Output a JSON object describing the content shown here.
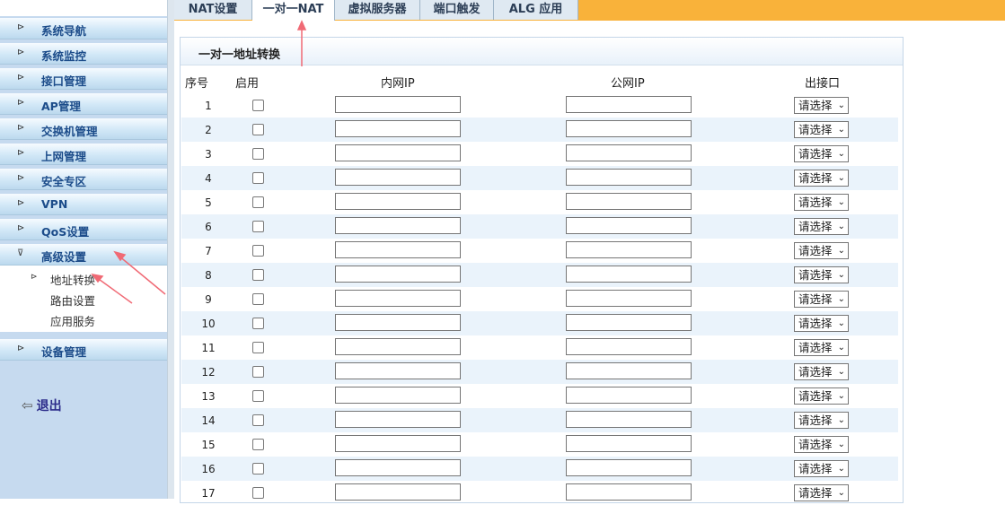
{
  "sidebar": {
    "items": [
      {
        "label": "系统导航"
      },
      {
        "label": "系统监控"
      },
      {
        "label": "接口管理"
      },
      {
        "label": "AP管理"
      },
      {
        "label": "交换机管理"
      },
      {
        "label": "上网管理"
      },
      {
        "label": "安全专区"
      },
      {
        "label": "VPN"
      },
      {
        "label": "QoS设置"
      },
      {
        "label": "高级设置"
      },
      {
        "label": "设备管理"
      }
    ],
    "submenu": [
      {
        "label": "地址转换",
        "selected": true
      },
      {
        "label": "路由设置"
      },
      {
        "label": "应用服务"
      }
    ],
    "logout": "退出"
  },
  "tabs": [
    {
      "label": "NAT设置"
    },
    {
      "label": "一对一NAT",
      "active": true
    },
    {
      "label": "虚拟服务器"
    },
    {
      "label": "端口触发"
    },
    {
      "label": "ALG 应用"
    }
  ],
  "panel": {
    "title": "一对一地址转换",
    "columns": [
      "序号",
      "启用",
      "内网IP",
      "公网IP",
      "出接口"
    ],
    "select_placeholder": "请选择",
    "rows": [
      "1",
      "2",
      "3",
      "4",
      "5",
      "6",
      "7",
      "8",
      "9",
      "10",
      "11",
      "12",
      "13",
      "14",
      "15",
      "16",
      "17"
    ]
  },
  "colors": {
    "tabbar": "#f9b23a",
    "sidebar": "#c6daef",
    "annotation": "#f06a75"
  }
}
